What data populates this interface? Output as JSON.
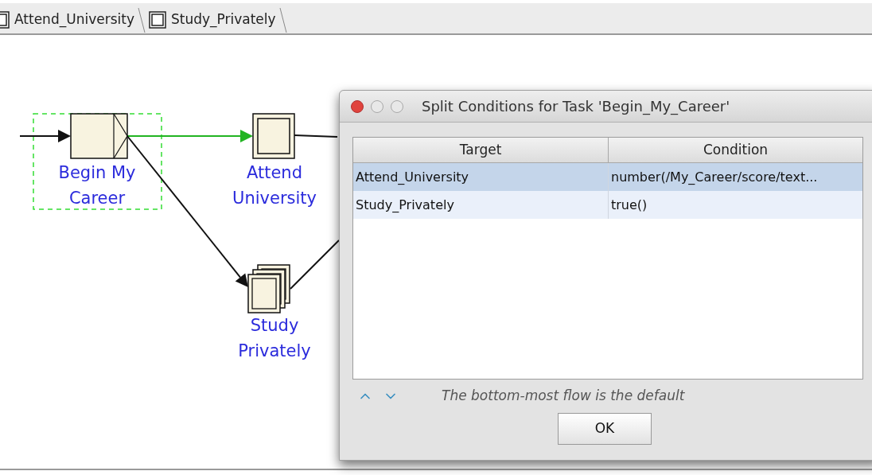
{
  "tabs": [
    {
      "label": "Attend_University"
    },
    {
      "label": "Study_Privately"
    }
  ],
  "diagram": {
    "nodes": [
      {
        "kind": "split_task",
        "label": "Begin My Career",
        "selected": true
      },
      {
        "kind": "task",
        "label": "Attend University",
        "selected": false
      },
      {
        "kind": "multi_task",
        "label": "Study Privately",
        "selected": false
      }
    ],
    "flows": [
      {
        "highlighted": false
      },
      {
        "highlighted": true
      },
      {
        "highlighted": false
      },
      {
        "highlighted": false
      },
      {
        "highlighted": false
      }
    ]
  },
  "dialog": {
    "title": "Split Conditions for Task 'Begin_My_Career'",
    "columns": [
      "Target",
      "Condition"
    ],
    "rows": [
      {
        "target": "Attend_University",
        "condition": "number(/My_Career/score/text...",
        "selected": true
      },
      {
        "target": "Study_Privately",
        "condition": "true()",
        "selected": false
      }
    ],
    "hint": "The bottom-most flow is the default",
    "button": "OK"
  }
}
